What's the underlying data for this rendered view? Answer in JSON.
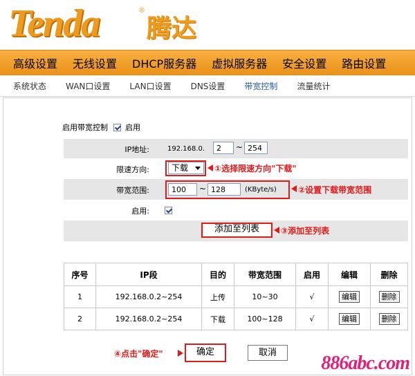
{
  "brand": {
    "logo_text": "Tenda",
    "registered": "®",
    "logo_cn": "腾达",
    "accent": "#f09a1c"
  },
  "main_nav": [
    "高级设置",
    "无线设置",
    "DHCP服务器",
    "虚拟服务器",
    "安全设置",
    "路由设置"
  ],
  "sub_nav": {
    "items": [
      "系统状态",
      "WAN口设置",
      "LAN口设置",
      "DNS设置",
      "带宽控制",
      "流量统计"
    ],
    "active_index": 4
  },
  "form": {
    "enable_control_label": "启用带宽控制",
    "enable_control_checked": true,
    "enable_control_text": "启用",
    "ip_label": "IP地址:",
    "ip_prefix": "192.168.0.",
    "ip_start": "2",
    "ip_sep": "~",
    "ip_end": "254",
    "direction_label": "限速方向:",
    "direction_value": "下载",
    "range_label": "带宽范围:",
    "range_min": "100",
    "range_sep": "~",
    "range_max": "128",
    "range_unit": "(KByte/s)",
    "enable_label": "启用:",
    "enable_checked": true,
    "add_button": "添加至列表"
  },
  "annotations": {
    "a1": "①选择限速方向\"下载\"",
    "a2": "②设置下载带宽范围",
    "a3": "③添加至列表",
    "a4": "④点击\"确定\"",
    "color": "#e11b1b"
  },
  "table": {
    "headers": [
      "序号",
      "IP段",
      "目的",
      "带宽范围",
      "启用",
      "编辑",
      "删除"
    ],
    "rows": [
      {
        "no": "1",
        "ip": "192.168.0.2~254",
        "dir": "上传",
        "range": "10~30",
        "enabled": "√",
        "edit": "编辑",
        "del": "删除"
      },
      {
        "no": "2",
        "ip": "192.168.0.2~254",
        "dir": "下载",
        "range": "100~128",
        "enabled": "√",
        "edit": "编辑",
        "del": "删除"
      }
    ]
  },
  "buttons": {
    "ok": "确定",
    "cancel": "取消"
  },
  "watermark": "886abc.com"
}
